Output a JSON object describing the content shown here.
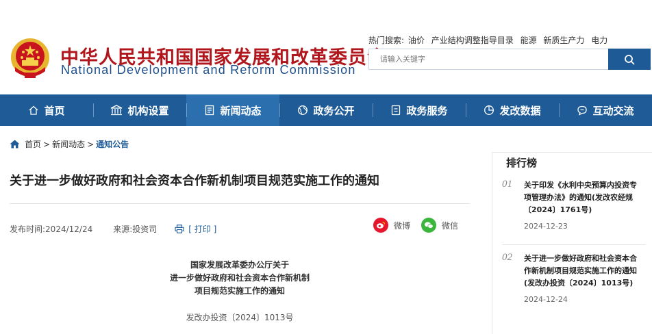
{
  "header": {
    "title_cn": "中华人民共和国国家发展和改革委员会",
    "title_en": "National Development and Reform Commission",
    "hot_label": "热门搜索:",
    "hot_terms": [
      "油价",
      "产业结构调整指导目录",
      "能源",
      "新质生产力",
      "电力"
    ],
    "search_placeholder": "请输入关键字"
  },
  "nav": [
    {
      "label": "首页",
      "icon": "home-icon"
    },
    {
      "label": "机构设置",
      "icon": "building-icon"
    },
    {
      "label": "新闻动态",
      "icon": "news-icon"
    },
    {
      "label": "政务公开",
      "icon": "globe-icon"
    },
    {
      "label": "政务服务",
      "icon": "document-icon"
    },
    {
      "label": "发改数据",
      "icon": "pie-chart-icon"
    },
    {
      "label": "互动交流",
      "icon": "chat-icon"
    }
  ],
  "nav_active": "新闻动态",
  "breadcrumb": {
    "home": "首页",
    "sep": ">",
    "news": "新闻动态",
    "current": "通知公告"
  },
  "article": {
    "title": "关于进一步做好政府和社会资本合作新机制项目规范实施工作的通知",
    "date_label": "发布时间:",
    "date": "2024/12/24",
    "source_label": "来源:",
    "source": "投资司",
    "print": "[ 打印 ]",
    "share_weibo": "微博",
    "share_wechat": "微信",
    "doc_head_1": "国家发展改革委办公厅关于",
    "doc_head_2": "进一步做好政府和社会资本合作新机制",
    "doc_head_3": "项目规范实施工作的通知",
    "doc_no": "发改办投资〔2024〕1013号"
  },
  "ranking": {
    "title": "排行榜",
    "items": [
      {
        "num": "01",
        "line1": "关于印发《水利中央预算内投资专",
        "line2": "项管理办法》的通知(发改农经规",
        "line3": "〔2024〕1761号)",
        "date": "2024-12-23"
      },
      {
        "num": "02",
        "line1": "关于进一步做好政府和社会资本合",
        "line2": "作新机制项目规范实施工作的通知",
        "line3": "(发改办投资〔2024〕1013号)",
        "date": "2024-12-24"
      }
    ]
  },
  "colors": {
    "brand_red": "#b0161c",
    "brand_blue": "#1e5b97",
    "weibo_red": "#e6162d",
    "wechat_green": "#3bb53b"
  }
}
